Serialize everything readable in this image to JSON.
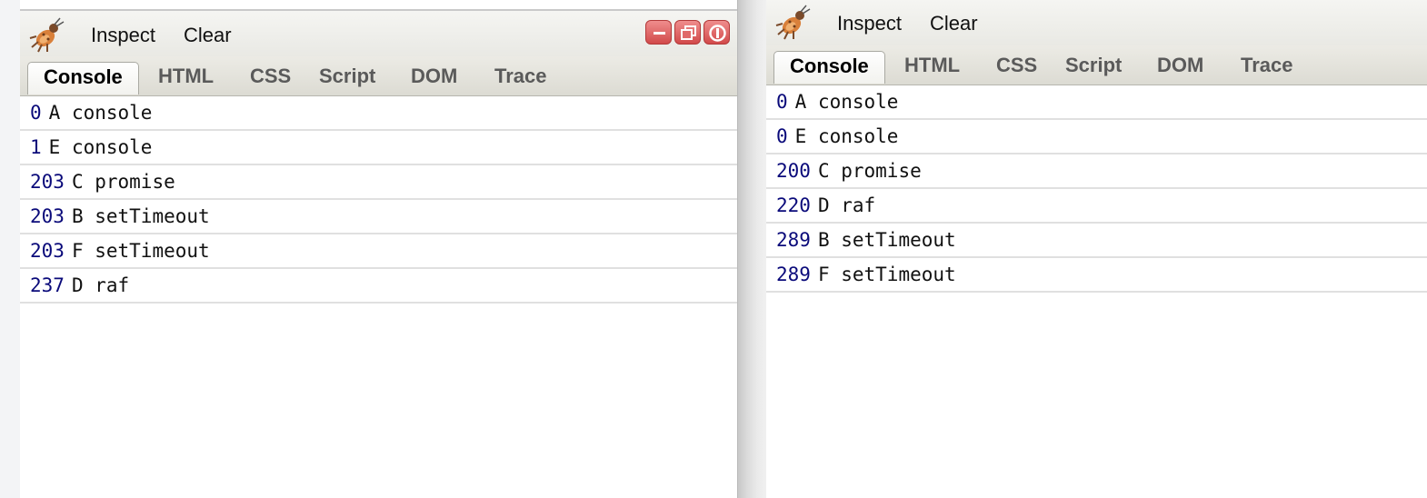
{
  "panels": [
    {
      "toolbar": {
        "inspect": "Inspect",
        "clear": "Clear",
        "icon": "firebug-icon"
      },
      "window_controls": [
        "minimize-icon",
        "restore-icon",
        "close-icon"
      ],
      "tabs": [
        "Console",
        "HTML",
        "CSS",
        "Script",
        "DOM",
        "Trace"
      ],
      "active_tab": "Console",
      "log": [
        {
          "time": "0",
          "text": "A console"
        },
        {
          "time": "1",
          "text": "E console"
        },
        {
          "time": "203",
          "text": "C promise"
        },
        {
          "time": "203",
          "text": "B setTimeout"
        },
        {
          "time": "203",
          "text": "F setTimeout"
        },
        {
          "time": "237",
          "text": "D raf"
        }
      ]
    },
    {
      "toolbar": {
        "inspect": "Inspect",
        "clear": "Clear",
        "icon": "firebug-icon"
      },
      "tabs": [
        "Console",
        "HTML",
        "CSS",
        "Script",
        "DOM",
        "Trace"
      ],
      "active_tab": "Console",
      "log": [
        {
          "time": "0",
          "text": "A console"
        },
        {
          "time": "0",
          "text": "E console"
        },
        {
          "time": "200",
          "text": "C promise"
        },
        {
          "time": "220",
          "text": "D raf"
        },
        {
          "time": "289",
          "text": "B setTimeout"
        },
        {
          "time": "289",
          "text": "F setTimeout"
        }
      ]
    }
  ],
  "colors": {
    "timestamp": "#0a0a7a",
    "close_button": "#d24a4a"
  }
}
